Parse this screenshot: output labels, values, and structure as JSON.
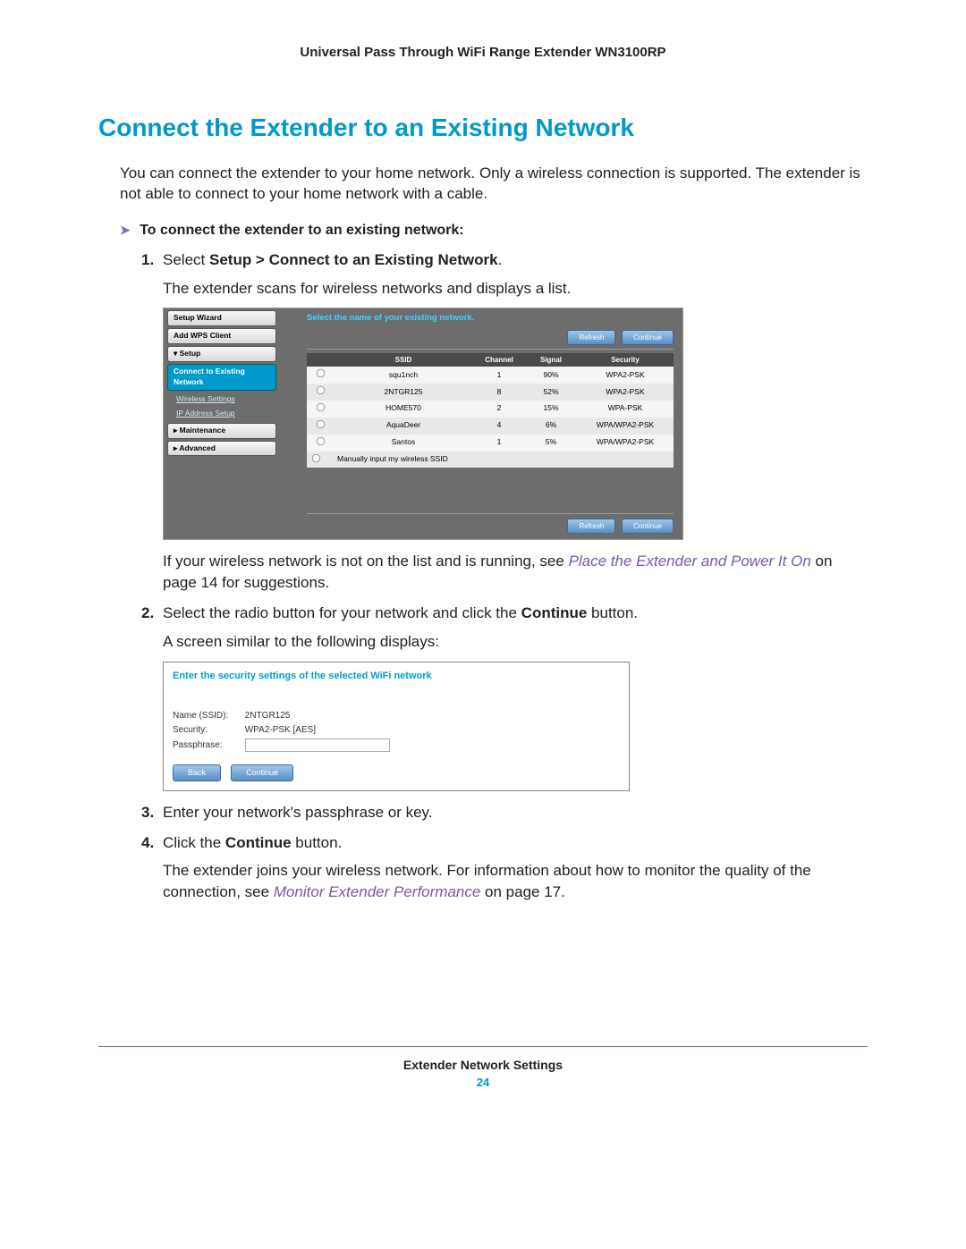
{
  "header": "Universal Pass Through WiFi Range Extender WN3100RP",
  "title": "Connect the Extender to an Existing Network",
  "intro": "You can connect the extender to your home network. Only a wireless connection is supported. The extender is not able to connect to your home network with a cable.",
  "task_heading": "To connect the extender to an existing network:",
  "steps": {
    "s1_prefix": "Select ",
    "s1_bold": "Setup > Connect to an Existing Network",
    "s1_suffix": ".",
    "s1_sub": "The extender scans for wireless networks and displays a list.",
    "s1_after1": "If your wireless network is not on the list and is running, see ",
    "s1_link": "Place the Extender and Power It On",
    "s1_after2": " on page 14 for suggestions.",
    "s2_a": "Select the radio button for your network and click the ",
    "s2_b": "Continue",
    "s2_c": " button.",
    "s2_sub": "A screen similar to the following displays:",
    "s3": "Enter your network's passphrase or key.",
    "s4_a": "Click the ",
    "s4_b": "Continue",
    "s4_c": " button.",
    "s4_sub1": "The extender joins your wireless network. For information about how to monitor the quality of the connection, see ",
    "s4_link": "Monitor Extender Performance",
    "s4_sub2": " on page 17."
  },
  "scr1": {
    "sidebar": {
      "wizard": "Setup Wizard",
      "wps": "Add WPS Client",
      "setup": "▾ Setup",
      "connect": "Connect to Existing Network",
      "wireless": "Wireless Settings",
      "ip": "IP Address Setup",
      "maint": "▸ Maintenance",
      "adv": "▸ Advanced"
    },
    "prompt": "Select the name of your existing network.",
    "refresh": "Refresh",
    "continue": "Continue",
    "cols": {
      "ssid": "SSID",
      "ch": "Channel",
      "sig": "Signal",
      "sec": "Security"
    },
    "rows": [
      {
        "ssid": "squ1nch",
        "ch": "1",
        "sig": "90%",
        "sec": "WPA2-PSK"
      },
      {
        "ssid": "2NTGR125",
        "ch": "8",
        "sig": "52%",
        "sec": "WPA2-PSK"
      },
      {
        "ssid": "HOME570",
        "ch": "2",
        "sig": "15%",
        "sec": "WPA-PSK"
      },
      {
        "ssid": "AquaDeer",
        "ch": "4",
        "sig": "6%",
        "sec": "WPA/WPA2-PSK"
      },
      {
        "ssid": "Santos",
        "ch": "1",
        "sig": "5%",
        "sec": "WPA/WPA2-PSK"
      }
    ],
    "manual": "Manually input my wireless SSID"
  },
  "scr2": {
    "prompt": "Enter the security settings of the selected WiFi network",
    "name_label": "Name (SSID):",
    "name_val": "2NTGR125",
    "sec_label": "Security:",
    "sec_val": "WPA2-PSK [AES]",
    "pass_label": "Passphrase:",
    "back": "Back",
    "continue": "Continue"
  },
  "footer": {
    "title": "Extender Network Settings",
    "page": "24"
  }
}
